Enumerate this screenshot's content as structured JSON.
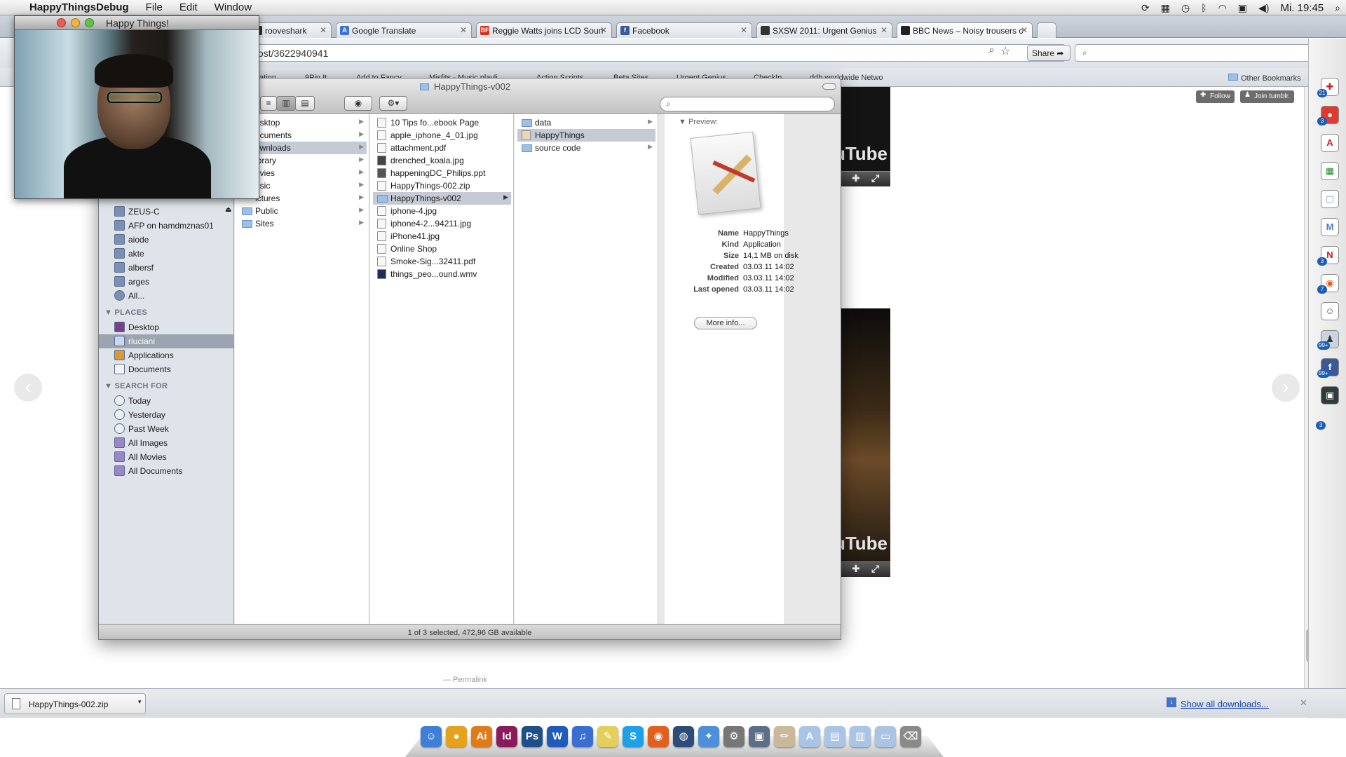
{
  "menubar": {
    "app_name": "HappyThingsDebug",
    "menus": [
      "File",
      "Edit",
      "Window"
    ],
    "clock": "Mi. 19:45"
  },
  "browser": {
    "tabs": [
      {
        "label": "rooveshark",
        "favicon": "grooveshark-icon",
        "color": "#333333"
      },
      {
        "label": "Google Translate",
        "favicon": "google-translate-icon",
        "color": "#3a74d9"
      },
      {
        "label": "Reggie Watts joins LCD Soun",
        "favicon": "bf-icon",
        "color": "#d4311d",
        "fav_text": "BF"
      },
      {
        "label": "Facebook",
        "favicon": "facebook-icon",
        "color": "#3b5998",
        "fav_text": "f"
      },
      {
        "label": "SXSW 2011: Urgent Genius",
        "favicon": "sxsw-icon",
        "color": "#333333"
      },
      {
        "label": "BBC News – Noisy trousers c",
        "favicon": "bbc-icon",
        "color": "#222222"
      }
    ],
    "url": "e/2#/post/3622940941",
    "share_label": "Share",
    "bookmarks": [
      "unication",
      "9Pin It",
      "Add to Fancy",
      "Misfits - Music playli",
      "Action Scripts",
      "Beta Sites",
      "Urgent Genius",
      "CheckIn",
      "ddb worldwide Netwo"
    ],
    "other_bookmarks": "Other Bookmarks",
    "tumblr_follow": "Follow",
    "tumblr_join": "Join tumblr.",
    "permalink": "— Permalink",
    "download_item": "HappyThings-002.zip",
    "show_all_downloads": "Show all downloads..."
  },
  "webcam": {
    "title": "Happy Things!"
  },
  "finder": {
    "title": "HappyThings-v002",
    "search_placeholder": "",
    "sidebar": {
      "shared_items": [
        "ZEUS-C",
        "AFP on hamdmznas01",
        "aiode",
        "akte",
        "albersf",
        "arges",
        "All..."
      ],
      "places_header": "PLACES",
      "places": [
        "Desktop",
        "rluciani",
        "Applications",
        "Documents"
      ],
      "search_header": "SEARCH FOR",
      "search_for": [
        "Today",
        "Yesterday",
        "Past Week",
        "All Images",
        "All Movies",
        "All Documents"
      ]
    },
    "column1": [
      "esktop",
      "ocuments",
      "ownloads",
      "ibrary",
      "ovies",
      "usic",
      "ictures",
      "Public",
      "Sites"
    ],
    "column2": [
      "10 Tips fo...ebook Page",
      "apple_iphone_4_01.jpg",
      "attachment.pdf",
      "drenched_koala.jpg",
      "happeningDC_Philips.ppt",
      "HappyThings-002.zip",
      "HappyThings-v002",
      "iphone-4.jpg",
      "iphone4-2...94211.jpg",
      "iPhone41.jpg",
      "Online Shop",
      "Smoke-Sig...32411.pdf",
      "things_peo...ound.wmv"
    ],
    "column3": [
      "data",
      "HappyThings",
      "source code"
    ],
    "preview": {
      "header": "Preview:",
      "fields": [
        {
          "label": "Name",
          "value": "HappyThings"
        },
        {
          "label": "Kind",
          "value": "Application"
        },
        {
          "label": "Size",
          "value": "14,1 MB on disk"
        },
        {
          "label": "Created",
          "value": "03.03.11 14:02"
        },
        {
          "label": "Modified",
          "value": "03.03.11 14:02"
        },
        {
          "label": "Last opened",
          "value": "03.03.11 14:02"
        }
      ],
      "more_info": "More info..."
    },
    "status": "1 of 3 selected, 472,96 GB available"
  },
  "right_sidebar_badges": [
    "21",
    "3",
    "3",
    "7",
    "99+",
    "99+",
    "3"
  ],
  "dock_apps": [
    {
      "name": "finder-icon",
      "glyph": "☺",
      "color": "#3f7fd6"
    },
    {
      "name": "adium-icon",
      "glyph": "●",
      "color": "#e6a21c"
    },
    {
      "name": "illustrator-icon",
      "glyph": "Ai",
      "color": "#e07b1a"
    },
    {
      "name": "indesign-icon",
      "glyph": "Id",
      "color": "#8b1a5a"
    },
    {
      "name": "photoshop-icon",
      "glyph": "Ps",
      "color": "#1d4f8a"
    },
    {
      "name": "word-icon",
      "glyph": "W",
      "color": "#1f5bb8"
    },
    {
      "name": "itunes-icon",
      "glyph": "♫",
      "color": "#3a6fd1"
    },
    {
      "name": "stickies-icon",
      "glyph": "✎",
      "color": "#e4cf5a"
    },
    {
      "name": "skype-icon",
      "glyph": "S",
      "color": "#1ea1e8"
    },
    {
      "name": "firefox-icon",
      "glyph": "◉",
      "color": "#e0601d"
    },
    {
      "name": "network-icon",
      "glyph": "◍",
      "color": "#2c4c7a"
    },
    {
      "name": "safari-icon",
      "glyph": "✦",
      "color": "#4d8fd8"
    },
    {
      "name": "system-preferences-icon",
      "glyph": "⚙",
      "color": "#777777"
    },
    {
      "name": "iphoto-icon",
      "glyph": "▣",
      "color": "#5c6f87"
    },
    {
      "name": "xcode-icon",
      "glyph": "✏",
      "color": "#c9b99a"
    },
    {
      "name": "applications-folder-icon",
      "glyph": "A",
      "color": "#a9c4e4"
    },
    {
      "name": "documents-folder-icon",
      "glyph": "▤",
      "color": "#a9c4e4"
    },
    {
      "name": "downloads-folder-icon",
      "glyph": "▥",
      "color": "#a9c4e4"
    },
    {
      "name": "folder-icon",
      "glyph": "▭",
      "color": "#a9c4e4"
    },
    {
      "name": "trash-icon",
      "glyph": "⌫",
      "color": "#8a8a8a"
    }
  ]
}
